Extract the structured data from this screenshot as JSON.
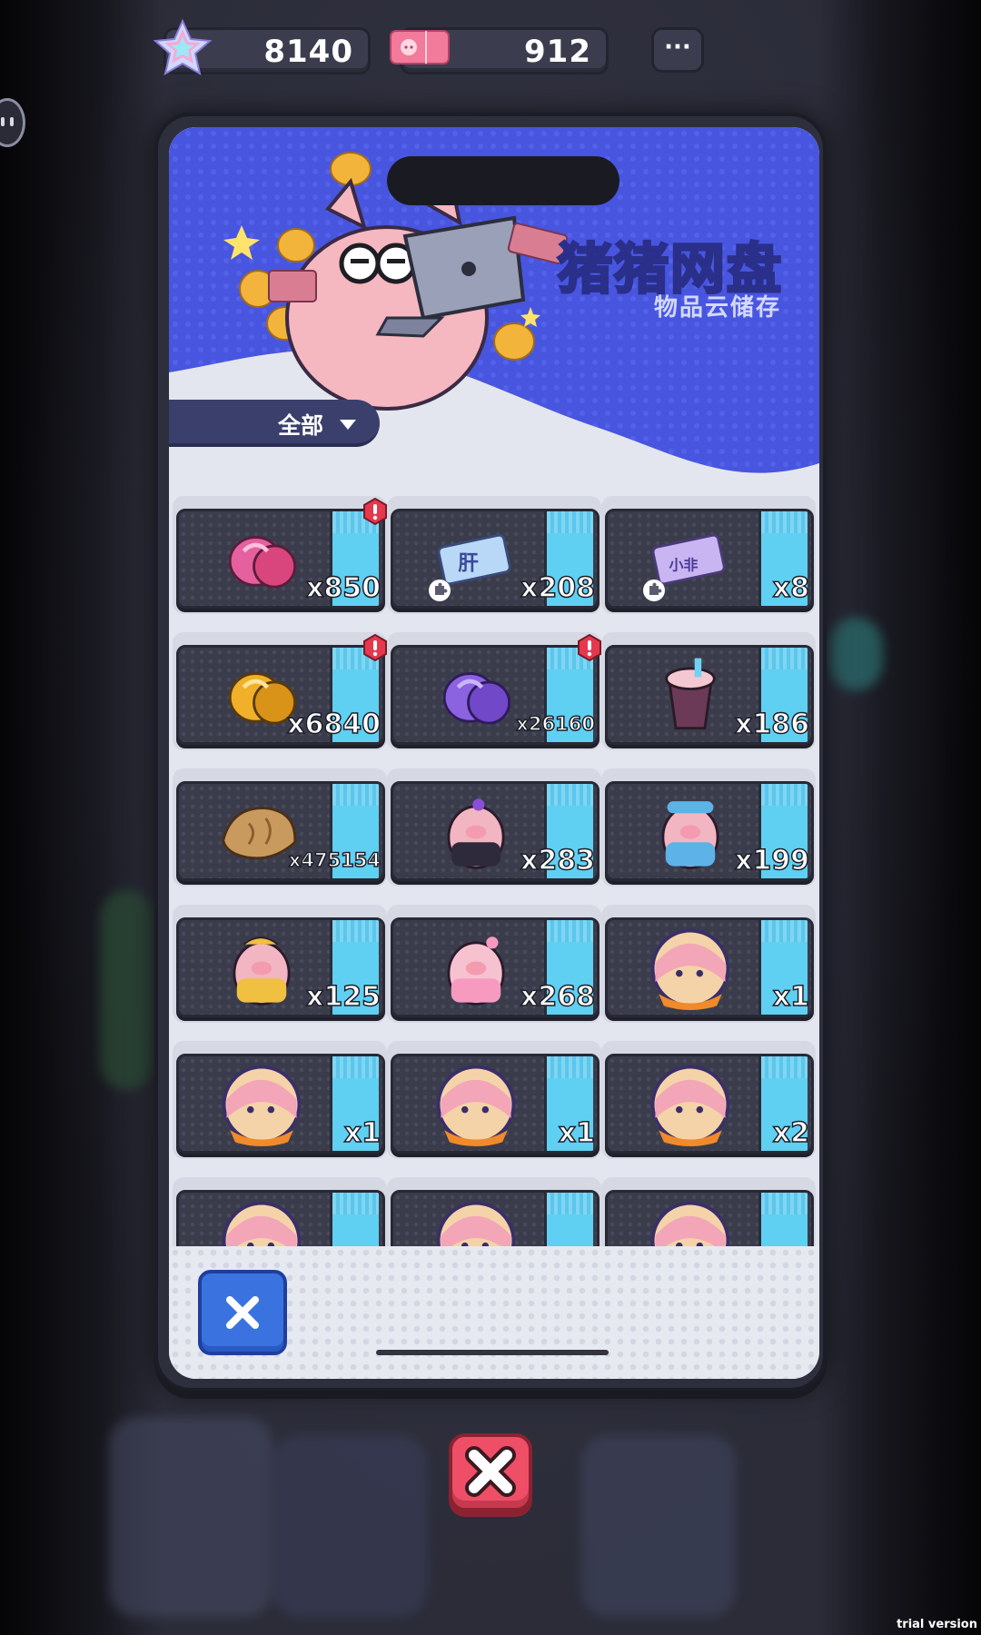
{
  "top_bar": {
    "star_currency": {
      "icon": "star-gem-icon",
      "value": "8140"
    },
    "ticket_currency": {
      "icon": "pig-ticket-icon",
      "value": "912"
    },
    "more_label": "···"
  },
  "header": {
    "title": "猪猪网盘",
    "subtitle": "物品云储存"
  },
  "filter": {
    "label": "全部"
  },
  "items": [
    {
      "icon": "pink-stone-icon",
      "qty": "x850",
      "alert": true
    },
    {
      "icon": "liver-ticket-icon",
      "qty": "x208",
      "alert": false,
      "puzzle": true
    },
    {
      "icon": "xiaofei-ticket-icon",
      "qty": "x8",
      "alert": false,
      "puzzle": true
    },
    {
      "icon": "gold-stone-icon",
      "qty": "x6840",
      "alert": true
    },
    {
      "icon": "purple-stone-icon",
      "qty": "x26160",
      "alert": true
    },
    {
      "icon": "milk-tea-icon",
      "qty": "x186",
      "alert": false
    },
    {
      "icon": "croissant-icon",
      "qty": "x475154",
      "alert": false
    },
    {
      "icon": "purple-pig-icon",
      "qty": "x283",
      "alert": false
    },
    {
      "icon": "blue-pig-icon",
      "qty": "x199",
      "alert": false
    },
    {
      "icon": "yellow-pig-icon",
      "qty": "x125",
      "alert": false
    },
    {
      "icon": "pink-pig-icon",
      "qty": "x268",
      "alert": false
    },
    {
      "icon": "character-portrait-icon",
      "qty": "x1",
      "alert": false
    },
    {
      "icon": "character-portrait-icon",
      "qty": "x1",
      "alert": false
    },
    {
      "icon": "character-portrait-icon",
      "qty": "x1",
      "alert": false
    },
    {
      "icon": "character-portrait-icon",
      "qty": "x2",
      "alert": false
    },
    {
      "icon": "character-portrait-icon",
      "qty": "",
      "alert": false
    },
    {
      "icon": "character-portrait-icon",
      "qty": "",
      "alert": false
    },
    {
      "icon": "character-portrait-icon",
      "qty": "",
      "alert": false
    }
  ],
  "colors": {
    "header_blue": "#4a57e0",
    "stripe_cyan": "#5fd0f2",
    "card_dark": "#3a3c4c",
    "alert_red": "#e5384f",
    "close_blue": "#3a73e0",
    "close_red": "#ef4f66"
  },
  "watermark": "trial version"
}
